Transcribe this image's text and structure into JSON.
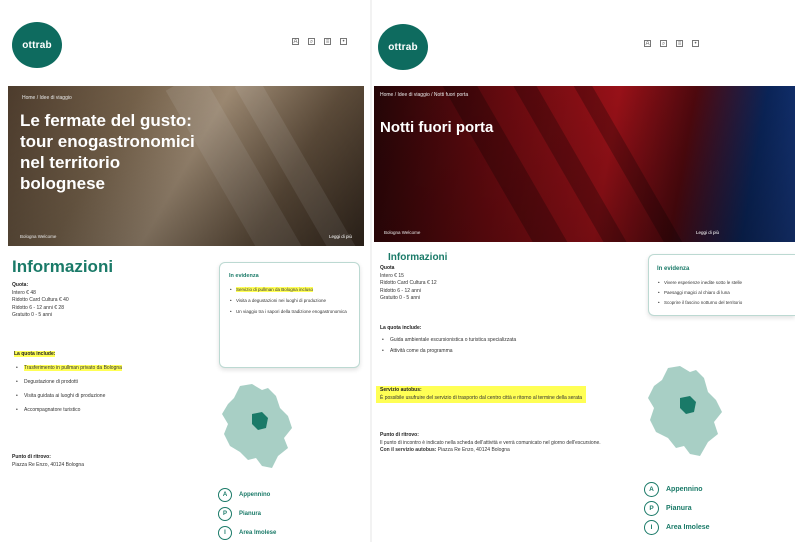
{
  "left": {
    "logo_text": "ottrab",
    "hero": {
      "breadcrumb": "Home / Idee di viaggio",
      "title": "Le fermate del gusto: tour enogastronomici nel territorio bolognese",
      "credit": "Bologna Welcome",
      "date": "Leggi di più"
    },
    "info_title": "Informazioni",
    "quota": {
      "heading": "Quota:",
      "lines": [
        "Intero € 48",
        "Ridotto Card Cultura € 40",
        "Ridotto 6 - 12 anni € 28",
        "Gratuito 0 - 5 anni"
      ]
    },
    "includes": {
      "heading": "La quota include:",
      "items": [
        "Trasferimento in pullman privato da Bologna",
        "Degustazione di prodotti",
        "Visita guidata ai luoghi di produzione",
        "Accompagnatore turistico"
      ]
    },
    "meet": {
      "heading": "Punto di ritrovo:",
      "text": "Piazza Re Enzo, 40124 Bologna"
    },
    "evidence": {
      "title": "In evidenza",
      "items": [
        "Servizio di pullman da Bologna incluso",
        "Visita a degustazioni nei luoghi di produzione",
        "Un viaggio tra i sapori della tradizione enogastronomica"
      ]
    },
    "areas": [
      {
        "badge": "A",
        "label": "Appennino"
      },
      {
        "badge": "P",
        "label": "Pianura"
      },
      {
        "badge": "I",
        "label": "Area Imolese"
      }
    ]
  },
  "right": {
    "logo_text": "ottrab",
    "hero": {
      "breadcrumb": "Home / Idee di viaggio / Notti fuori porta",
      "title": "Notti fuori porta",
      "credit": "Bologna Welcome",
      "date": "Leggi di più"
    },
    "info_title": "Informazioni",
    "quota": {
      "heading": "Quota",
      "lines": [
        "Intero € 15",
        "Ridotto Card Cultura € 12",
        "Ridotto 6 - 12 anni",
        "Gratuito 0 - 5 anni"
      ]
    },
    "includes": {
      "heading": "La quota include:",
      "items": [
        "Guida ambientale escursionistica o turistica specializzata",
        "Attività come da programma"
      ]
    },
    "service": {
      "heading": "Servizio autobus:",
      "text": "È possibile usufruire del servizio di trasporto dal centro città e ritorno al termine della serata"
    },
    "meet": {
      "heading": "Punto di ritrovo:",
      "text": "Il punto di incontro è indicato nella scheda dell'attività e verrà comunicato nel giorno dell'escursione.",
      "service_label": "Con il servizio autobus:",
      "service_text": "Piazza Re Enzo, 40124 Bologna"
    },
    "evidence": {
      "title": "In evidenza",
      "items": [
        "Vivere esperienze inedite sotto le stelle",
        "Paesaggi magici al chiaro di luna",
        "Scoprire il fascino notturno del territorio"
      ]
    },
    "areas": [
      {
        "badge": "A",
        "label": "Appennino"
      },
      {
        "badge": "P",
        "label": "Pianura"
      },
      {
        "badge": "I",
        "label": "Area Imolese"
      }
    ]
  },
  "colors": {
    "accent": "#1a7a68",
    "logo_bg": "#0e6b5f",
    "highlight": "#ffff55",
    "map_fill": "#a8cfc5",
    "map_center": "#1a7a68"
  },
  "icons": [
    "translate-icon",
    "search-icon",
    "menu-icon",
    "user-icon"
  ]
}
